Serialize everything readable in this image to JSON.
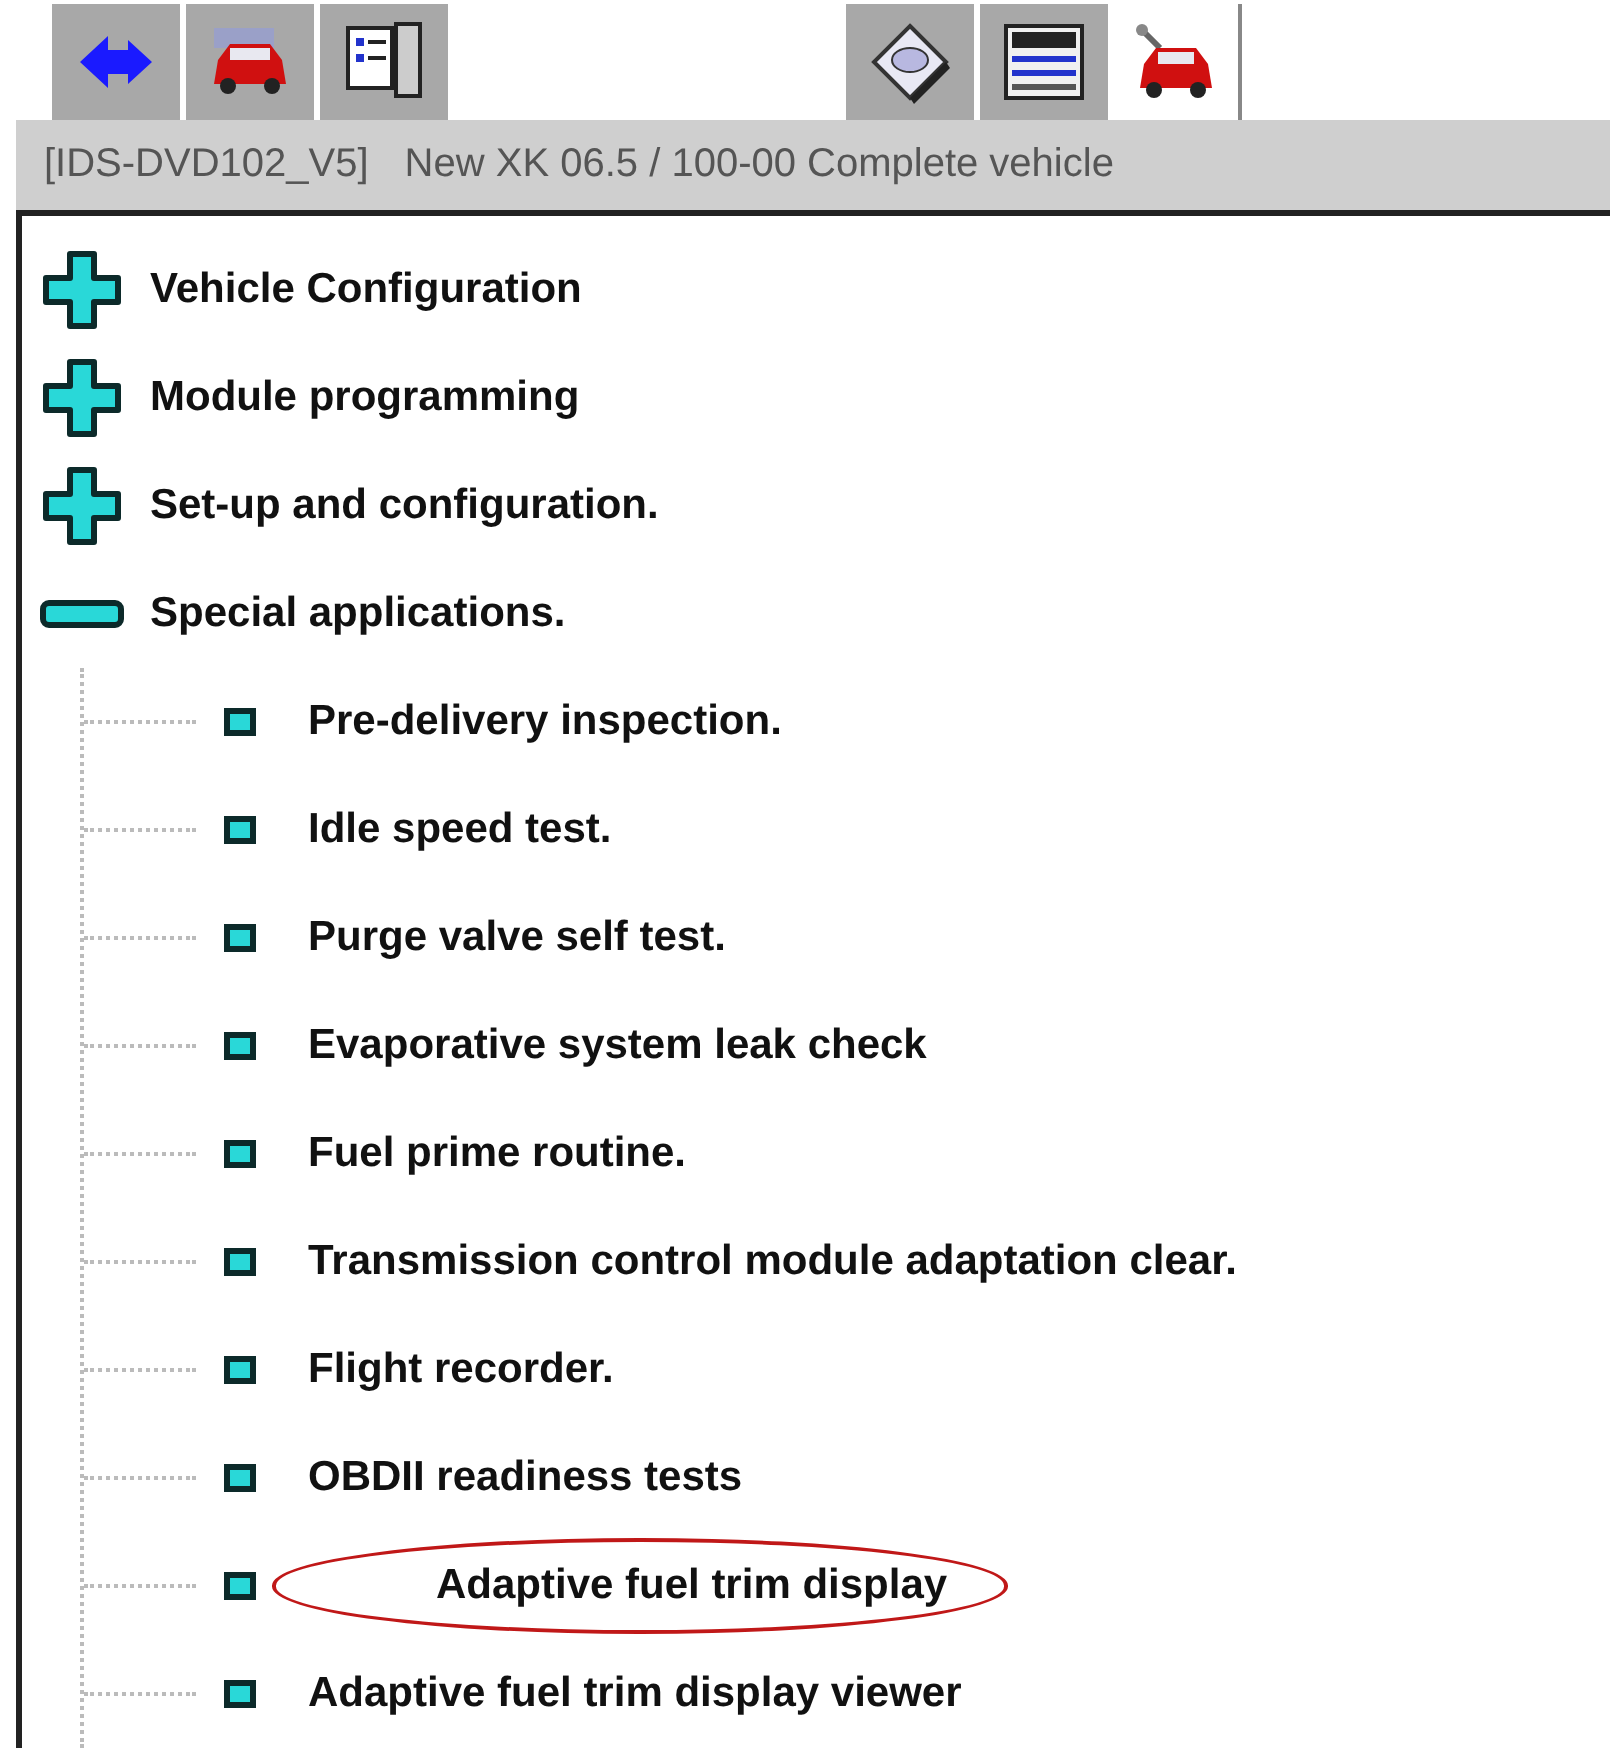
{
  "toolbar": [
    {
      "kind": "back",
      "selected": false
    },
    {
      "kind": "car",
      "selected": false
    },
    {
      "kind": "document",
      "selected": false
    },
    {
      "kind": "disc",
      "selected": false
    },
    {
      "kind": "panel",
      "selected": false
    },
    {
      "kind": "car-tools",
      "selected": true
    }
  ],
  "header": {
    "session": "[IDS-DVD102_V5]",
    "vehicle": "New XK 06.5 / 100-00 Complete vehicle"
  },
  "tree": [
    {
      "label": "Vehicle Configuration",
      "expanded": false
    },
    {
      "label": "Module programming",
      "expanded": false
    },
    {
      "label": "Set-up and configuration.",
      "expanded": false
    },
    {
      "label": "Special applications.",
      "expanded": true,
      "children": [
        {
          "label": "Pre-delivery inspection.",
          "circled": false
        },
        {
          "label": "Idle speed test.",
          "circled": false
        },
        {
          "label": "Purge valve self test.",
          "circled": false
        },
        {
          "label": "Evaporative system leak check",
          "circled": false
        },
        {
          "label": "Fuel prime routine.",
          "circled": false
        },
        {
          "label": "Transmission control module adaptation clear.",
          "circled": false
        },
        {
          "label": "Flight recorder.",
          "circled": false
        },
        {
          "label": "OBDII readiness tests",
          "circled": false
        },
        {
          "label": "Adaptive fuel trim display",
          "circled": true
        },
        {
          "label": "Adaptive fuel trim display viewer",
          "circled": false
        }
      ]
    }
  ]
}
